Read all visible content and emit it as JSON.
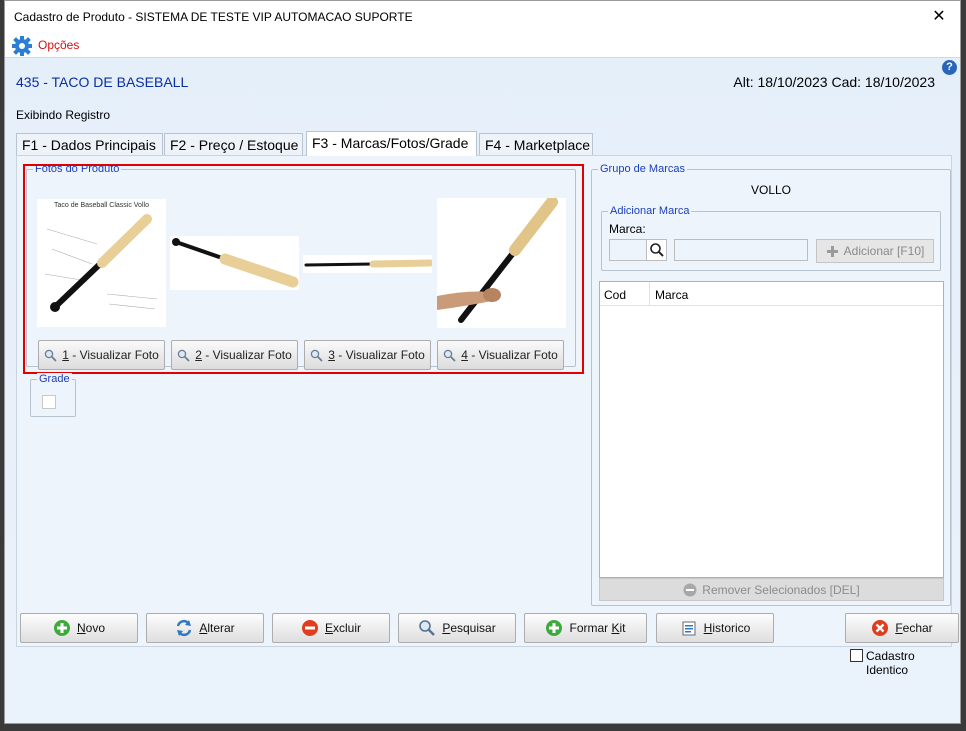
{
  "window": {
    "title": "Cadastro de Produto - SISTEMA DE TESTE VIP AUTOMACAO SUPORTE",
    "close_glyph": "✕",
    "menu_opcoes": "Opções"
  },
  "header": {
    "product_title": "435 - TACO DE BASEBALL",
    "dates": "Alt: 18/10/2023 Cad: 18/10/2023",
    "help": "?",
    "status": "Exibindo Registro"
  },
  "tabs": [
    {
      "label": "F1 - Dados Principais"
    },
    {
      "label": "F2 - Preço / Estoque"
    },
    {
      "label": "F3 - Marcas/Fotos/Grade"
    },
    {
      "label": "F4 - Marketplace"
    }
  ],
  "photos": {
    "legend": "Fotos do Produto",
    "photo1_caption": "Taco de Baseball Classic Vollo",
    "buttons": [
      {
        "key": "1",
        "label": " - Visualizar Foto"
      },
      {
        "key": "2",
        "label": " - Visualizar Foto"
      },
      {
        "key": "3",
        "label": " - Visualizar Foto"
      },
      {
        "key": "4",
        "label": " - Visualizar Foto"
      }
    ]
  },
  "grade": {
    "legend": "Grade"
  },
  "marcas": {
    "legend": "Grupo de Marcas",
    "brand_value": "VOLLO",
    "add_legend": "Adicionar Marca",
    "marca_label": "Marca:",
    "add_button": "Adicionar [F10]",
    "columns": [
      "Cod",
      "Marca"
    ],
    "remove_button": "Remover Selecionados [DEL]"
  },
  "cadastro_identico": "Cadastro Identico",
  "bottom_buttons": [
    {
      "key": "N",
      "rest": "ovo"
    },
    {
      "key": "A",
      "rest": "lterar"
    },
    {
      "key": "E",
      "rest": "xcluir"
    },
    {
      "key": "P",
      "rest": "esquisar"
    },
    {
      "pre": "Formar ",
      "key": "K",
      "rest": "it"
    },
    {
      "key": "H",
      "rest": "istorico"
    },
    {
      "key": "F",
      "rest": "echar"
    }
  ],
  "colors": {
    "accent_blue": "#0a2fa0",
    "highlight_red": "#e00000",
    "menu_red": "#d01010"
  }
}
